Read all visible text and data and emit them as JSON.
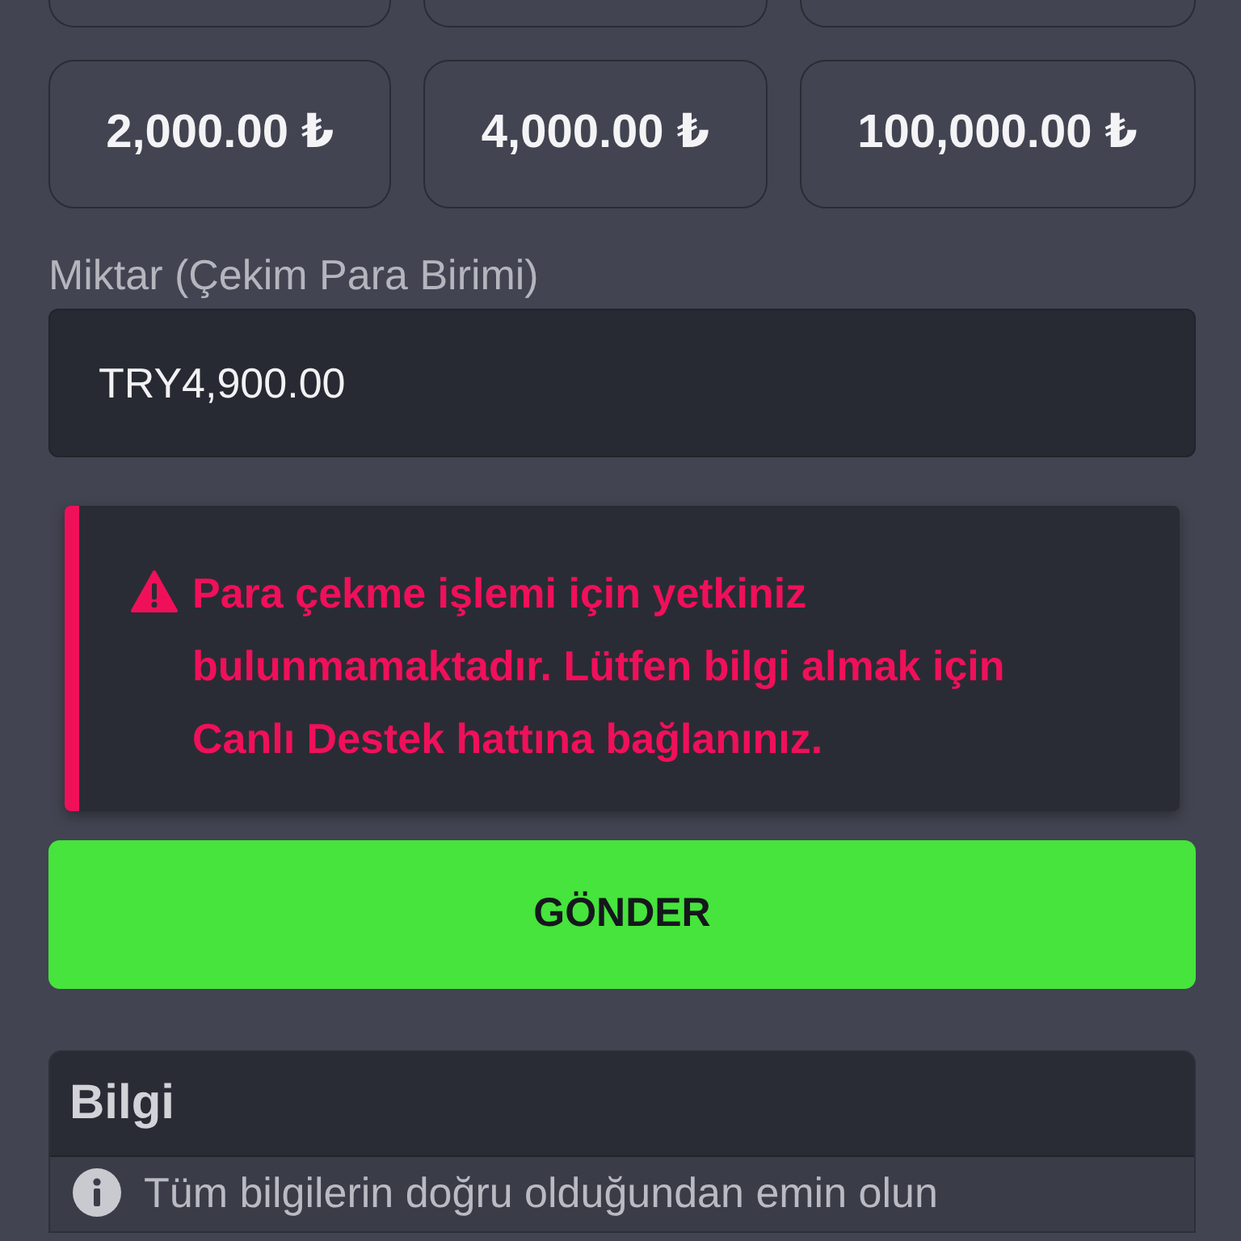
{
  "amount_buttons": [
    {
      "kind": "clipped"
    },
    {
      "kind": "clipped"
    },
    {
      "kind": "clipped"
    },
    {
      "kind": "full",
      "label": "2,000.00 ₺"
    },
    {
      "kind": "full",
      "label": "4,000.00 ₺"
    },
    {
      "kind": "full",
      "label": "100,000.00 ₺"
    }
  ],
  "amount_field": {
    "label": "Miktar (Çekim Para Birimi)",
    "value": "TRY4,900.00"
  },
  "alert": {
    "kind": "danger",
    "message": "Para çekme işlemi için yetkiniz bulunmamaktadır. Lütfen bilgi almak için Canlı Destek hattına bağlanınız."
  },
  "submit_button": {
    "label": "GÖNDER"
  },
  "info_panel": {
    "title": "Bilgi",
    "items": [
      {
        "text": "Tüm bilgilerin doğru olduğundan emin olun"
      }
    ]
  }
}
